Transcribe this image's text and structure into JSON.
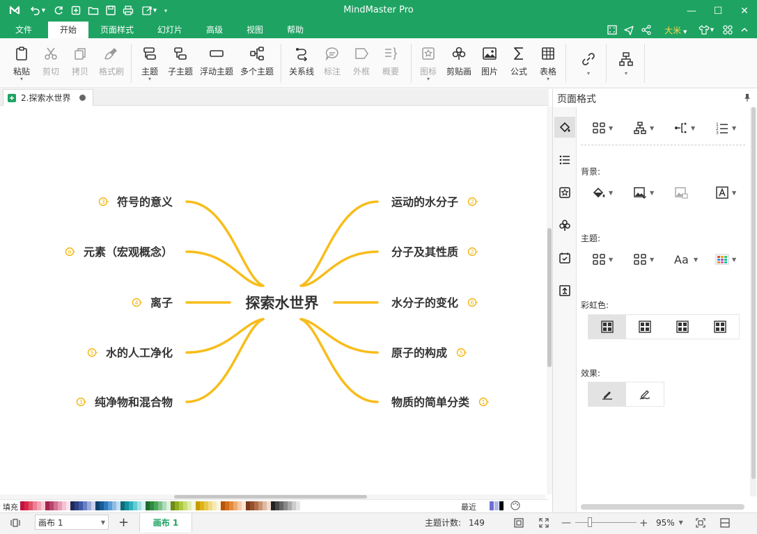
{
  "app": {
    "title": "MindMaster Pro",
    "user": "大米"
  },
  "menu": {
    "tabs": [
      "文件",
      "开始",
      "页面样式",
      "幻灯片",
      "高级",
      "视图",
      "帮助"
    ],
    "active": "开始"
  },
  "ribbon": {
    "paste": "粘贴",
    "cut": "剪切",
    "copy": "拷贝",
    "format_painter": "格式刷",
    "topic": "主题",
    "subtopic": "子主题",
    "floating_topic": "浮动主题",
    "multiple_topics": "多个主题",
    "relationship": "关系线",
    "callout": "标注",
    "boundary": "外框",
    "summary": "概要",
    "icon": "图标",
    "clipart": "剪贴画",
    "picture": "图片",
    "formula": "公式",
    "table": "表格"
  },
  "document": {
    "tab_name": "2.探索水世界"
  },
  "mindmap": {
    "central": "探索水世界",
    "left": [
      {
        "text": "符号的意义",
        "badge": "3"
      },
      {
        "text": "元素（宏观概念）",
        "badge": "6"
      },
      {
        "text": "离子",
        "badge": "4"
      },
      {
        "text": "水的人工净化",
        "badge": "5"
      },
      {
        "text": "纯净物和混合物",
        "badge": "3"
      }
    ],
    "right": [
      {
        "text": "运动的水分子",
        "badge": "2"
      },
      {
        "text": "分子及其性质",
        "badge": "2"
      },
      {
        "text": "水分子的变化",
        "badge": "6"
      },
      {
        "text": "原子的构成",
        "badge": "5"
      },
      {
        "text": "物质的简单分类",
        "badge": "1"
      }
    ],
    "branch_color": "#f7bd1b"
  },
  "colorbar": {
    "fill_label": "填充",
    "recent_label": "最近"
  },
  "status": {
    "canvas_select": "画布 1",
    "canvas_tab": "画布 1",
    "topic_count_label": "主题计数:",
    "topic_count": "149",
    "zoom": "95%"
  },
  "panel": {
    "title": "页面格式",
    "background_label": "背景:",
    "theme_label": "主题:",
    "rainbow_label": "彩虹色:",
    "effect_label": "效果:"
  },
  "colors": {
    "accent": "#1ea362",
    "branch": "#f7bd1b"
  }
}
